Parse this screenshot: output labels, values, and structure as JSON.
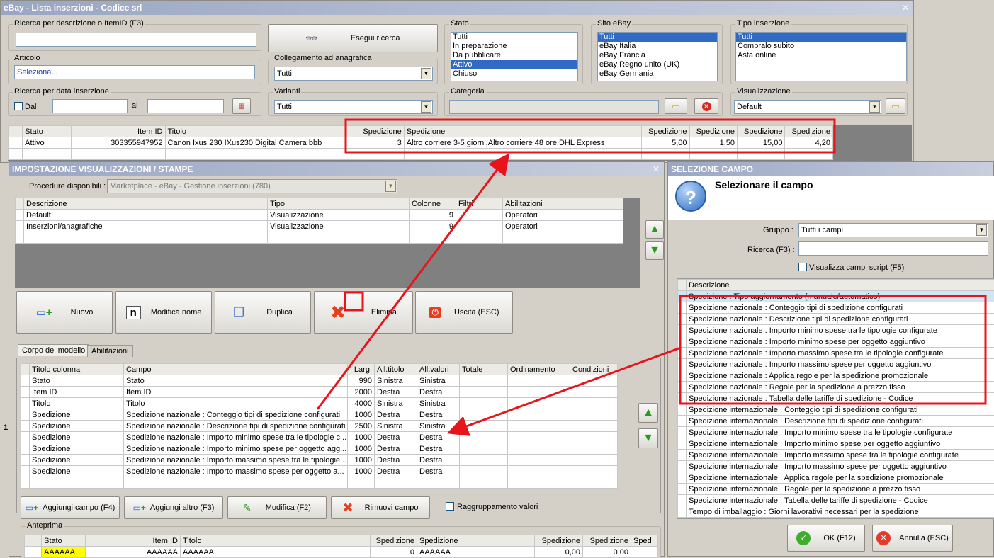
{
  "main_window": {
    "title": "eBay - Lista inserzioni - Codice srl",
    "search_label": "Ricerca per descrizione o ItemID (F3)",
    "search_value": "",
    "search_button": "Esegui ricerca",
    "article_label": "Articolo",
    "article_value": "Seleziona...",
    "link_label": "Collegamento ad anagrafica",
    "link_value": "Tutti",
    "date_label": "Ricerca per data inserzione",
    "date_from_label": "Dal",
    "date_to_label": "al",
    "variants_label": "Varianti",
    "variants_value": "Tutti",
    "stato_label": "Stato",
    "stato_items": [
      "Tutti",
      "In preparazione",
      "Da pubblicare",
      "Attivo",
      "Chiuso"
    ],
    "stato_selected": 3,
    "site_label": "Sito eBay",
    "site_items": [
      "Tutti",
      "eBay Italia",
      "eBay Francia",
      "eBay Regno unito (UK)",
      "eBay Germania"
    ],
    "site_selected": 0,
    "type_label": "Tipo inserzione",
    "type_items": [
      "Tutti",
      "Compralo subito",
      "Asta online"
    ],
    "type_selected": 0,
    "category_label": "Categoria",
    "view_label": "Visualizzazione",
    "view_value": "Default",
    "grid_headers": [
      "Stato",
      "Item ID",
      "Titolo",
      "Spedizione",
      "Spedizione",
      "Spedizione",
      "Spedizione",
      "Spedizione",
      "Spedizione"
    ],
    "grid_row": [
      "Attivo",
      "303355947952",
      "Canon Ixus 230 IXus230 Digital Camera bbb",
      "3",
      "Altro corriere 3-5 giorni,Altro corriere 48 ore,DHL Express",
      "5,00",
      "1,50",
      "15,00",
      "4,20"
    ],
    "side_digit": "1"
  },
  "settings_window": {
    "title": "IMPOSTAZIONE VISUALIZZAZIONI / STAMPE",
    "procedures_label": "Procedure disponibili :",
    "procedures_value": "Marketplace - eBay - Gestione inserzioni (780)",
    "grid_headers": [
      "Descrizione",
      "Tipo",
      "Colonne",
      "Filtri",
      "Abilitazioni"
    ],
    "grid_rows": [
      [
        "Default",
        "Visualizzazione",
        "9",
        "",
        "Operatori"
      ],
      [
        "Inserzioni/anagrafiche",
        "Visualizzazione",
        "9",
        "",
        "Operatori"
      ]
    ],
    "buttons": {
      "new": "Nuovo",
      "rename": "Modifica nome",
      "duplicate": "Duplica",
      "delete": "Elimina",
      "exit": "Uscita (ESC)"
    },
    "tabs": [
      "Corpo del modello",
      "Abilitazioni"
    ],
    "body_headers": [
      "Titolo colonna",
      "Campo",
      "Larg.",
      "All.titolo",
      "All.valori",
      "Totale",
      "Ordinamento",
      "Condizioni"
    ],
    "body_rows": [
      [
        "Stato",
        "Stato",
        "990",
        "Sinistra",
        "Sinistra"
      ],
      [
        "Item ID",
        "Item ID",
        "2000",
        "Destra",
        "Destra"
      ],
      [
        "Titolo",
        "Titolo",
        "4000",
        "Sinistra",
        "Sinistra"
      ],
      [
        "Spedizione",
        "Spedizione nazionale : Conteggio tipi di spedizione configurati",
        "1000",
        "Destra",
        "Destra"
      ],
      [
        "Spedizione",
        "Spedizione nazionale : Descrizione  tipi di spedizione configurati",
        "2500",
        "Sinistra",
        "Sinistra"
      ],
      [
        "Spedizione",
        "Spedizione nazionale : Importo minimo spese tra le tipologie c...",
        "1000",
        "Destra",
        "Destra"
      ],
      [
        "Spedizione",
        "Spedizione nazionale : Importo minimo spese per oggetto agg...",
        "1000",
        "Destra",
        "Destra"
      ],
      [
        "Spedizione",
        "Spedizione nazionale : Importo massimo spese tra le tipologie ...",
        "1000",
        "Destra",
        "Destra"
      ],
      [
        "Spedizione",
        "Spedizione nazionale : Importo massimo spese per oggetto a...",
        "1000",
        "Destra",
        "Destra"
      ]
    ],
    "bottom_buttons": {
      "add_field": "Aggiungi campo (F4)",
      "add_other": "Aggiungi altro (F3)",
      "edit": "Modifica (F2)",
      "remove": "Rimuovi campo"
    },
    "group_values": "Raggruppamento valori",
    "preview_label": "Anteprima",
    "preview_headers": [
      "Stato",
      "Item ID",
      "Titolo",
      "Spedizione",
      "Spedizione",
      "Spedizione",
      "Spedizione",
      "Sped"
    ],
    "preview_row": [
      "AAAAAA",
      "AAAAAA",
      "AAAAAA",
      "0",
      "AAAAAA",
      "0,00",
      "0,00",
      ""
    ]
  },
  "field_window": {
    "title": "SELEZIONE CAMPO",
    "heading": "Selezionare il campo",
    "group_label": "Gruppo :",
    "group_value": "Tutti i campi",
    "search_label": "Ricerca (F3) :",
    "script_label": "Visualizza campi script (F5)",
    "list_header": "Descrizione",
    "items": [
      "Spedizione : Tipo aggiornamento (manuale/automatico)",
      "Spedizione nazionale : Conteggio tipi di spedizione configurati",
      "Spedizione nazionale : Descrizione  tipi di spedizione configurati",
      "Spedizione nazionale : Importo minimo spese tra le tipologie configurate",
      "Spedizione nazionale : Importo minimo spese per oggetto aggiuntivo",
      "Spedizione nazionale : Importo massimo spese tra le tipologie configurate",
      "Spedizione nazionale : Importo massimo spese per oggetto aggiuntivo",
      "Spedizione nazionale : Applica regole per la spedizione promozionale",
      "Spedizione nazionale : Regole per la spedizione a prezzo fisso",
      "Spedizione nazionale : Tabella delle tariffe di spedizione - Codice",
      "Spedizione internazionale : Conteggio tipi di spedizione configurati",
      "Spedizione internazionale : Descrizione  tipi di spedizione configurati",
      "Spedizione internazionale : Importo minimo spese tra le tipologie configurate",
      "Spedizione internazionale : Importo minimo spese per oggetto aggiuntivo",
      "Spedizione internazionale : Importo massimo spese tra le tipologie configurate",
      "Spedizione internazionale : Importo massimo spese per oggetto aggiuntivo",
      "Spedizione internazionale : Applica regole per la spedizione promozionale",
      "Spedizione internazionale : Regole per la spedizione a prezzo fisso",
      "Spedizione internazionale : Tabella delle tariffe di spedizione - Codice",
      "Tempo di imballaggio : Giorni lavorativi necessari per la spedizione"
    ],
    "ok_button": "OK (F12)",
    "cancel_button": "Annulla (ESC)"
  },
  "colors": {
    "annotation": "#e8141b",
    "selection": "#316ac5",
    "preview_highlight": "#ffff00"
  }
}
